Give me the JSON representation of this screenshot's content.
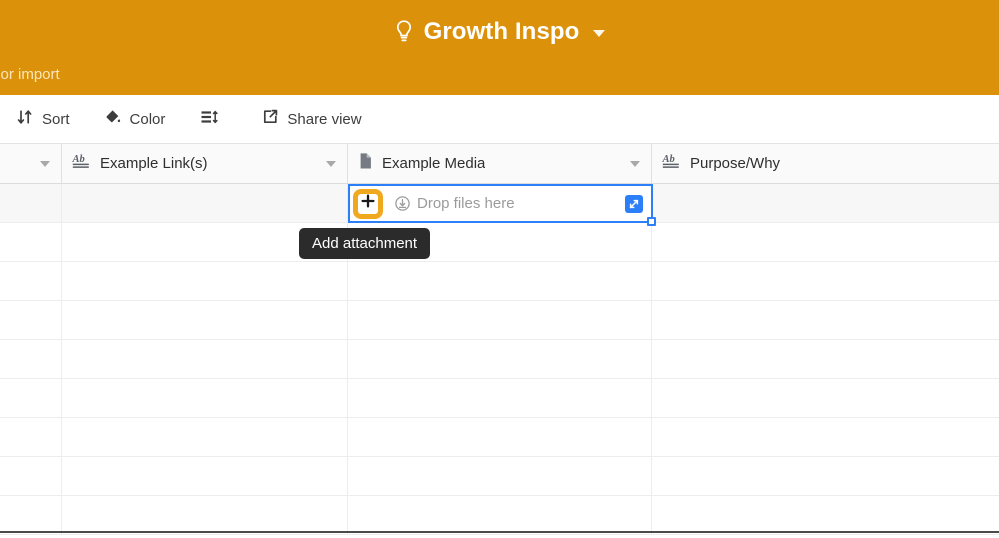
{
  "header": {
    "title": "Growth Inspo",
    "title_icon": "lightbulb-icon",
    "caret_icon": "chevron-down-icon",
    "partial_text": "d or import",
    "background_color": "#db9109"
  },
  "toolbar": {
    "items": [
      {
        "label": "Sort",
        "icon": "sort-arrows-icon"
      },
      {
        "label": "Color",
        "icon": "paint-bucket-icon"
      },
      {
        "label": "",
        "icon": "row-height-icon"
      },
      {
        "label": "Share view",
        "icon": "share-external-link-icon"
      }
    ]
  },
  "grid": {
    "columns": [
      {
        "name": "",
        "field_icon": "",
        "caret_icon": "chevron-down-icon"
      },
      {
        "name": "Example Link(s)",
        "field_icon": "long-text-ab-icon",
        "caret_icon": "chevron-down-icon"
      },
      {
        "name": "Example Media",
        "field_icon": "attachment-file-icon",
        "caret_icon": "chevron-down-icon"
      },
      {
        "name": "Purpose/Why",
        "field_icon": "long-text-ab-icon",
        "caret_icon": ""
      }
    ],
    "row_count": 9,
    "hovered_row_index": 0
  },
  "active_cell": {
    "column": "Example Media",
    "row_index": 0,
    "add_button_icon": "plus-icon",
    "add_button_highlight_color": "#f0a81e",
    "drop_hint_icon": "download-circle-icon",
    "drop_hint_text": "Drop files here",
    "expand_icon": "expand-record-icon",
    "selection_color": "#2d7ff9",
    "fill_handle_icon": "fill-handle"
  },
  "tooltip": {
    "text": "Add attachment",
    "background_color": "#2b2b2b"
  }
}
